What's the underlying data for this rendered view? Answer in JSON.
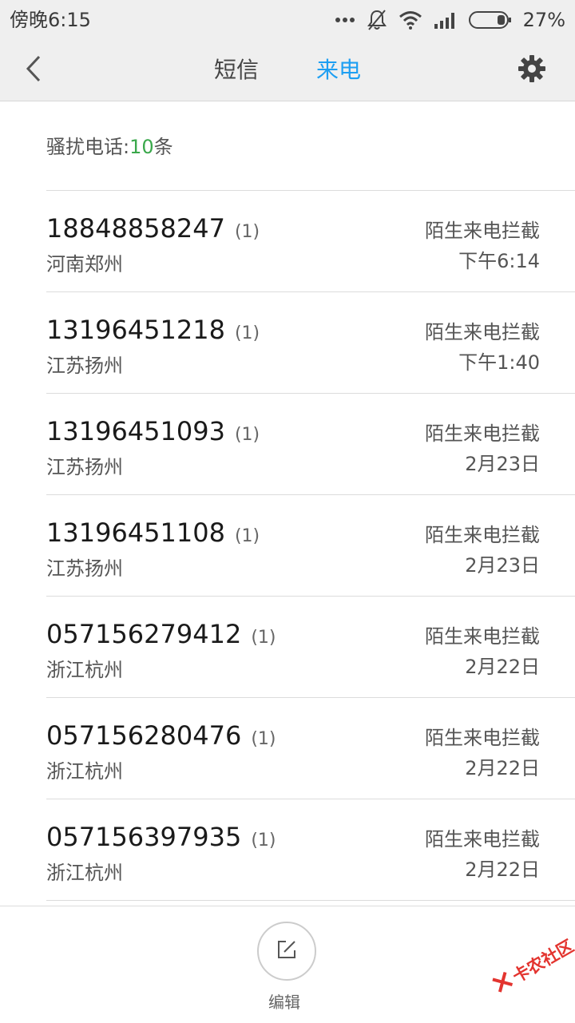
{
  "status_bar": {
    "time": "傍晚6:15",
    "battery": "27%",
    "icons": [
      "more-dots-icon",
      "bell-off-icon",
      "wifi-icon",
      "signal-icon",
      "battery-icon"
    ]
  },
  "header": {
    "back_icon": "chevron-left-icon",
    "tabs": [
      {
        "label": "短信",
        "active": false
      },
      {
        "label": "来电",
        "active": true
      }
    ],
    "settings_icon": "gear-icon",
    "active_color": "#1e9ff2"
  },
  "summary": {
    "label": "骚扰电话:",
    "count": "10",
    "unit": "条",
    "count_color": "#3aa84b"
  },
  "calls": [
    {
      "number": "18848858247",
      "count": "(1)",
      "location": "河南郑州",
      "type": "陌生来电拦截",
      "time": "下午6:14"
    },
    {
      "number": "13196451218",
      "count": "(1)",
      "location": "江苏扬州",
      "type": "陌生来电拦截",
      "time": "下午1:40"
    },
    {
      "number": "13196451093",
      "count": "(1)",
      "location": "江苏扬州",
      "type": "陌生来电拦截",
      "time": "2月23日"
    },
    {
      "number": "13196451108",
      "count": "(1)",
      "location": "江苏扬州",
      "type": "陌生来电拦截",
      "time": "2月23日"
    },
    {
      "number": "057156279412",
      "count": "(1)",
      "location": "浙江杭州",
      "type": "陌生来电拦截",
      "time": "2月22日"
    },
    {
      "number": "057156280476",
      "count": "(1)",
      "location": "浙江杭州",
      "type": "陌生来电拦截",
      "time": "2月22日"
    },
    {
      "number": "057156397935",
      "count": "(1)",
      "location": "浙江杭州",
      "type": "陌生来电拦截",
      "time": "2月22日"
    }
  ],
  "bottom_bar": {
    "edit_icon": "edit-icon",
    "edit_label": "编辑"
  },
  "watermark": {
    "text": "卡农社区",
    "color": "#e3342f"
  }
}
